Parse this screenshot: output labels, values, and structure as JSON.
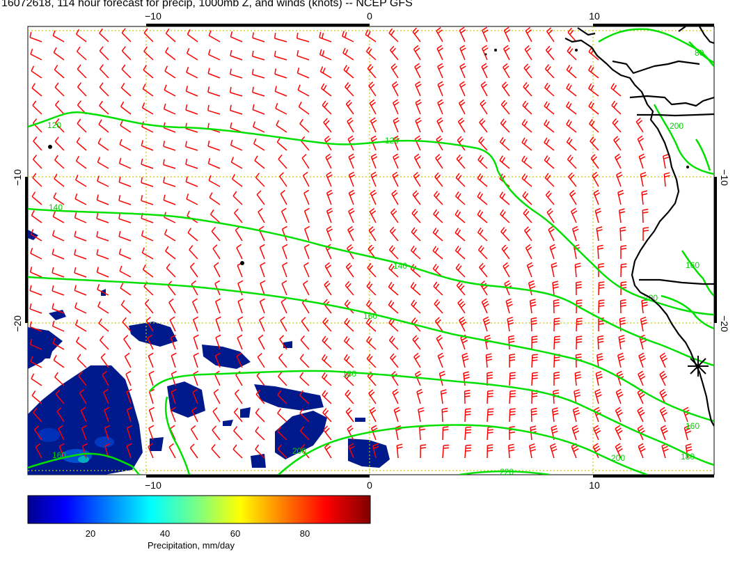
{
  "title": "16072618, 114 hour forecast for precip, 1000mb Z, and winds (knots) -- NCEP GFS",
  "map": {
    "lon_range": [
      -15.5,
      15
    ],
    "lat_range": [
      -27,
      -0.5
    ],
    "x_ticks": [
      -10,
      0,
      10
    ],
    "y_ticks": [
      -10,
      -20
    ],
    "tick_labels": {
      "top": [
        "−10",
        "0",
        "10"
      ],
      "bottom": [
        "−10",
        "0",
        "10"
      ],
      "left": [
        "−10",
        "−20"
      ],
      "right": [
        "−10",
        "−20"
      ]
    },
    "grid_color": "#c8c800",
    "contour_color": "#00e000",
    "barb_color": "#ff0000",
    "coast_color": "#000000",
    "contour_labels": [
      "120",
      "120",
      "140",
      "140",
      "160",
      "160",
      "160",
      "160",
      "180",
      "180",
      "200",
      "200",
      "200",
      "200",
      "220",
      "80"
    ],
    "marker": "asterisk"
  },
  "colorbar": {
    "ticks": [
      "20",
      "40",
      "60",
      "80"
    ],
    "label": "Precipitation, mm/day",
    "range": [
      0,
      100
    ]
  }
}
